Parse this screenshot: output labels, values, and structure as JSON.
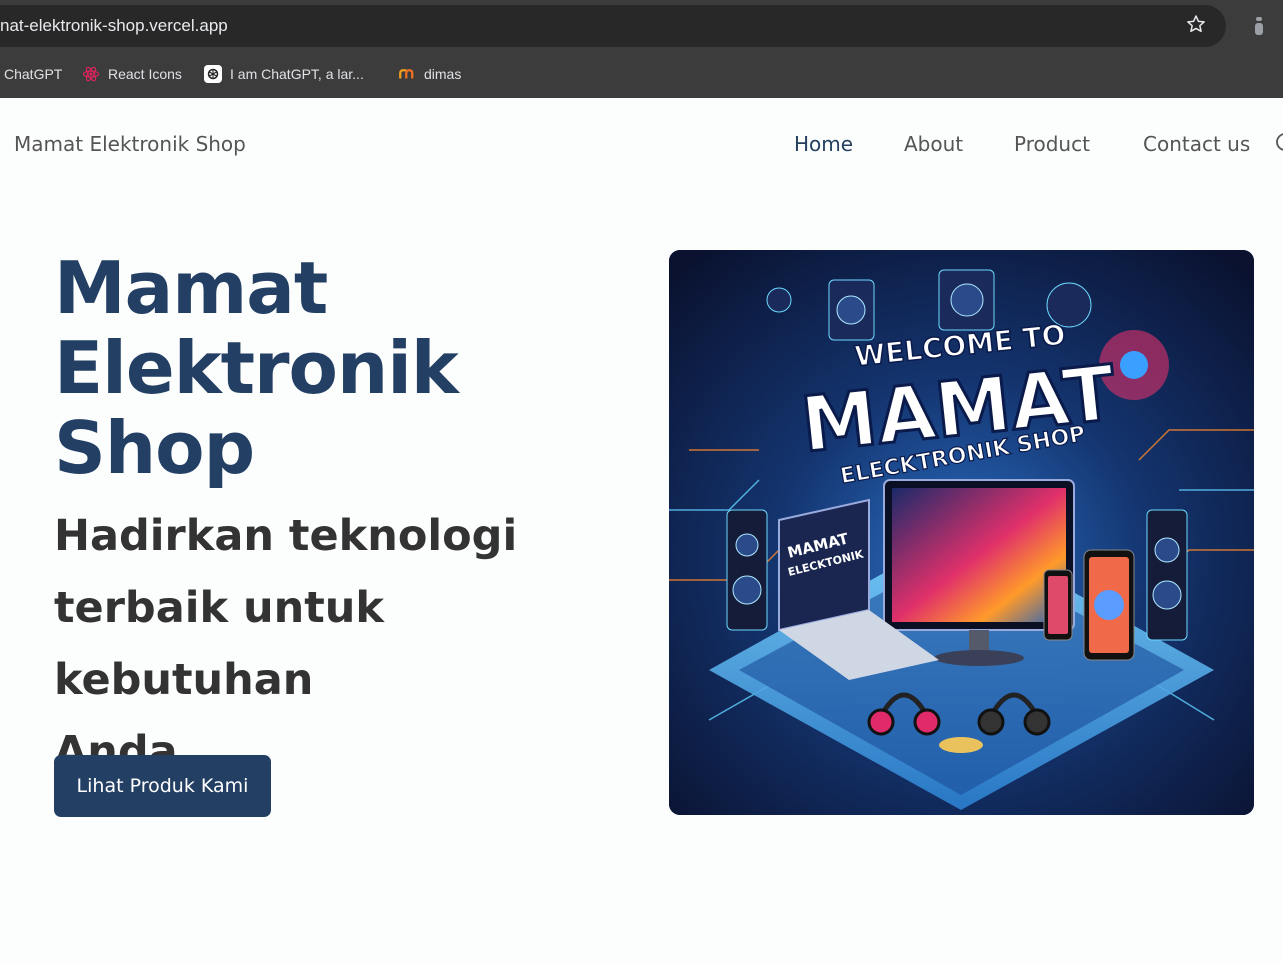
{
  "browser": {
    "url": "nat-elektronik-shop.vercel.app",
    "bookmarks": [
      {
        "label": "ChatGPT",
        "icon": "chatgpt-icon"
      },
      {
        "label": "React Icons",
        "icon": "react-icon"
      },
      {
        "label": "I am ChatGPT, a lar...",
        "icon": "openai-icon"
      },
      {
        "label": "dimas",
        "icon": "dimas-favicon"
      }
    ]
  },
  "nav": {
    "brand": "Mamat Elektronik Shop",
    "links": [
      "Home",
      "About",
      "Product",
      "Contact us"
    ],
    "active": "Home"
  },
  "hero": {
    "title_line1": "Mamat",
    "title_line2": "Elektronik",
    "title_line3": "Shop",
    "subtitle_line1": "Hadirkan teknologi",
    "subtitle_line2": "terbaik untuk kebutuhan",
    "subtitle_line3": "Anda.",
    "cta_label": "Lihat Produk Kami",
    "image": {
      "text_welcome": "WELCOME TO",
      "text_brand": "MAMAT",
      "text_sub": "ELECKTRONIK SHOP",
      "screen_text_1": "MAMAT",
      "screen_text_2": "ELECKTONIK"
    }
  },
  "colors": {
    "primary": "#233f63",
    "chrome_bg": "#3c3c3c",
    "urlbar_bg": "#282828"
  }
}
